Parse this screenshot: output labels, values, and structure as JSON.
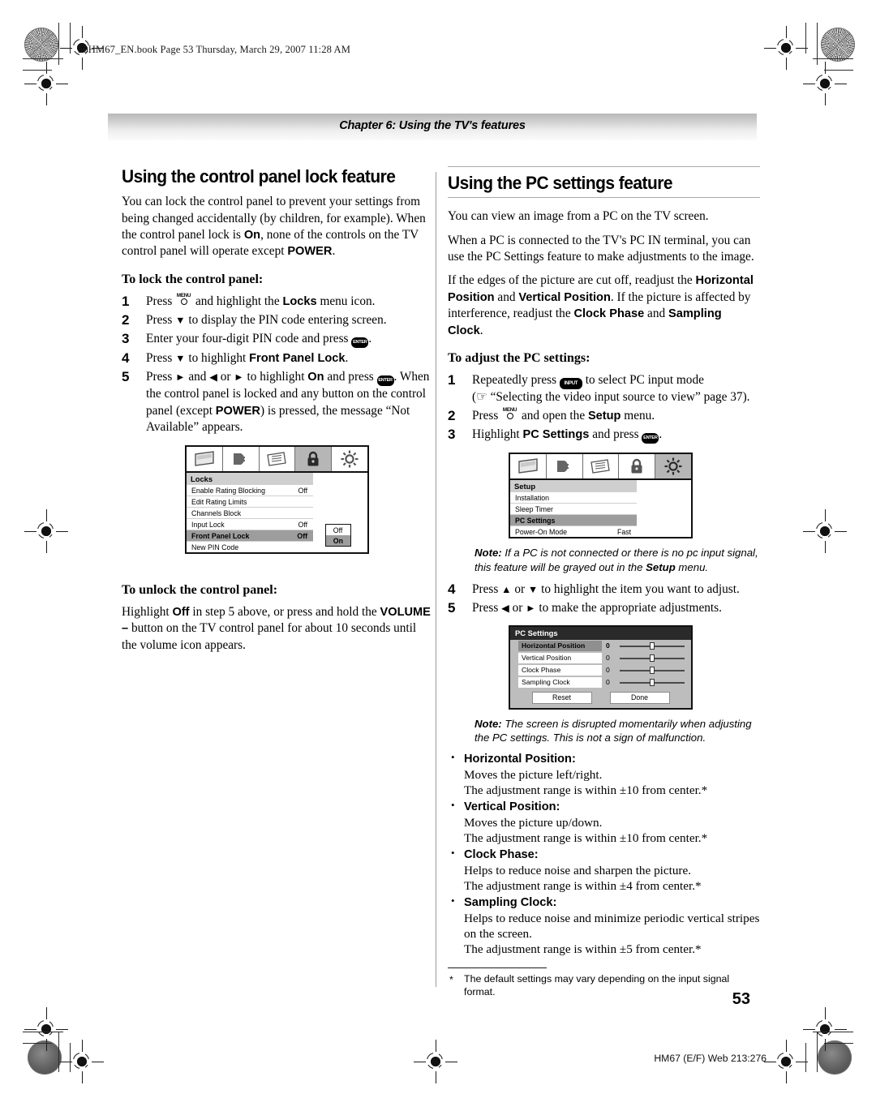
{
  "file_header": "50HM67_EN.book  Page 53  Thursday, March 29, 2007  11:28 AM",
  "chapter_bar": "Chapter 6: Using the TV's features",
  "page_number": "53",
  "footer": "HM67 (E/F) Web 213:276",
  "left_column": {
    "heading": "Using the control panel lock feature",
    "intro_parts": {
      "a": "You can lock the control panel to prevent your settings from being changed accidentally (by children, for example). When the control panel lock is ",
      "on": "On",
      "b": ", none of the controls on the TV control panel will operate except ",
      "power": "POWER",
      "c": "."
    },
    "lock_subhead": "To lock the control panel:",
    "steps": [
      {
        "num": "1",
        "pre": "Press ",
        "key": "MENU",
        "mid": " and highlight the ",
        "bold": "Locks",
        "post": " menu icon."
      },
      {
        "num": "2",
        "pre": "Press ",
        "key": "down-arrow",
        "mid": " to display the PIN code entering screen.",
        "bold": "",
        "post": ""
      },
      {
        "num": "3",
        "pre": "Enter your four-digit PIN code and press ",
        "key": "ENTER",
        "mid": ".",
        "bold": "",
        "post": ""
      },
      {
        "num": "4",
        "pre": "Press ",
        "key": "down-arrow",
        "mid": " to highlight ",
        "bold": "Front Panel Lock",
        "post": "."
      },
      {
        "num": "5",
        "pre": "Press ",
        "key": "right-arrow",
        "mid": " and ",
        "bold": "On",
        "post": " and press "
      }
    ],
    "step5_text": {
      "p1": "Press ",
      "p2": " and ",
      "p3": " or ",
      "p4": " to highlight ",
      "on": "On",
      "p5": " and press ",
      "p6": ". When the control panel is locked and any button on the control panel (except ",
      "power": "POWER",
      "p7": ") is pressed, the message “Not Available” appears."
    },
    "unlock_subhead": "To unlock the control panel:",
    "unlock_text": {
      "a": "Highlight ",
      "off": "Off",
      "b": " in step 5 above, or press and hold the ",
      "vol": "VOLUME –",
      "c": " button on the TV control panel for about 10 seconds until the volume icon appears."
    },
    "locks_menu": {
      "title": "Locks",
      "icons": [
        "picture-icon",
        "audio-icon",
        "settings-card-icon",
        "lock-icon",
        "setup-sun-icon"
      ],
      "selected_icon_index": 3,
      "rows": [
        {
          "label": "Enable Rating Blocking",
          "value": "Off",
          "selected": false
        },
        {
          "label": "Edit Rating Limits",
          "value": "",
          "selected": false
        },
        {
          "label": "Channels Block",
          "value": "",
          "selected": false
        },
        {
          "label": "Input Lock",
          "value": "Off",
          "selected": false
        },
        {
          "label": "Front Panel Lock",
          "value": "Off",
          "selected": true
        },
        {
          "label": "New PIN Code",
          "value": "",
          "selected": false
        }
      ],
      "popup": [
        {
          "label": "Off",
          "selected": false
        },
        {
          "label": "On",
          "selected": true
        }
      ]
    }
  },
  "right_column": {
    "heading": "Using the PC settings feature",
    "para1": "You can view an image from a PC on the TV screen.",
    "para2": "When a PC is connected to the TV's PC IN terminal, you can use the PC Settings feature to make adjustments to the image.",
    "para3": {
      "a": "If the edges of the picture are cut off, readjust the ",
      "hp": "Horizontal Position",
      "b": " and ",
      "vp": "Vertical Position",
      "c": ". If the picture is affected by interference, readjust the ",
      "cp": "Clock Phase",
      "d": " and ",
      "sc": "Sampling Clock",
      "e": "."
    },
    "adjust_subhead": "To adjust the PC settings:",
    "step1": {
      "num": "1",
      "a": "Repeatedly press ",
      "key": "INPUT",
      "b": " to select PC input mode",
      "c": "(☞ “Selecting the video input source to view” page 37)."
    },
    "step2": {
      "num": "2",
      "a": "Press ",
      "key": "MENU",
      "b": " and open the ",
      "bold": "Setup",
      "c": " menu."
    },
    "step3": {
      "num": "3",
      "a": "Highlight ",
      "bold": "PC Settings",
      "b": " and press ",
      "key": "ENTER",
      "c": "."
    },
    "setup_menu": {
      "title": "Setup",
      "selected_icon_index": 4,
      "rows": [
        {
          "label": "Installation",
          "value": "",
          "selected": false
        },
        {
          "label": "Sleep Timer",
          "value": "",
          "selected": false
        },
        {
          "label": "PC Settings",
          "value": "",
          "selected": true
        },
        {
          "label": "Power-On Mode",
          "value": "Fast",
          "selected": false
        }
      ]
    },
    "note1": {
      "label": "Note:",
      "a": " If a PC is not connected or there is no pc input signal, this feature will be grayed out in the ",
      "bold": "Setup",
      "b": " menu."
    },
    "step4": {
      "num": "4",
      "a": "Press ",
      "b": " or ",
      "c": " to highlight the item you want to adjust."
    },
    "step5": {
      "num": "5",
      "a": "Press ",
      "b": " or ",
      "c": " to make the appropriate adjustments."
    },
    "pc_settings_panel": {
      "title": "PC Settings",
      "rows": [
        {
          "label": "Horizontal Position",
          "value": "0",
          "selected": true
        },
        {
          "label": "Vertical Position",
          "value": "0",
          "selected": false
        },
        {
          "label": "Clock Phase",
          "value": "0",
          "selected": false
        },
        {
          "label": "Sampling Clock",
          "value": "0",
          "selected": false
        }
      ],
      "buttons": [
        "Reset",
        "Done"
      ]
    },
    "note2": {
      "label": "Note:",
      "a": " The screen is disrupted momentarily when adjusting the PC settings. This is not a sign of malfunction."
    },
    "bullets": [
      {
        "head": "Horizontal Position:",
        "line1": "Moves the picture left/right.",
        "line2": "The adjustment range is within ±10 from center.*"
      },
      {
        "head": "Vertical Position:",
        "line1": "Moves the picture up/down.",
        "line2": "The adjustment range is within ±10 from center.*"
      },
      {
        "head": "Clock Phase:",
        "line1": "Helps to reduce noise and sharpen the picture.",
        "line2": "The adjustment range is within ±4 from center.*"
      },
      {
        "head": "Sampling Clock:",
        "line1": "Helps to reduce noise and minimize periodic vertical stripes on the screen.",
        "line2": "The adjustment range is within ±5 from center.*"
      }
    ],
    "footnote": {
      "star": "*",
      "text": "The default settings may vary depending on the input signal format."
    }
  }
}
